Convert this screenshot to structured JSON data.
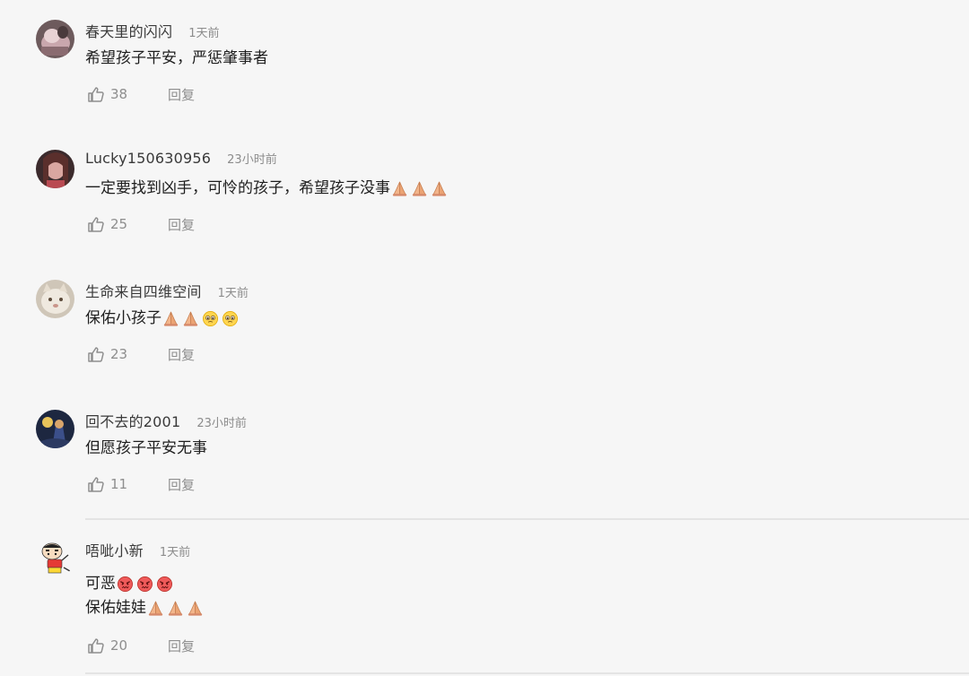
{
  "comments": [
    {
      "username": "春天里的闪闪",
      "time": "1天前",
      "lines": [
        {
          "text": "希望孩子平安，严惩肇事者",
          "emojis": []
        }
      ],
      "likes": "38",
      "reply_label": "回复",
      "avatar_icon": "avatar-photo-pink"
    },
    {
      "username": "Lucky150630956",
      "time": "23小时前",
      "lines": [
        {
          "text": "一定要找到凶手，可怜的孩子，希望孩子没事",
          "emojis": [
            "pray-emoji",
            "pray-emoji",
            "pray-emoji"
          ]
        }
      ],
      "likes": "25",
      "reply_label": "回复",
      "avatar_icon": "avatar-photo-portrait"
    },
    {
      "username": "生命来自四维空间",
      "time": "1天前",
      "lines": [
        {
          "text": "保佑小孩子",
          "emojis": [
            "pray-emoji",
            "pray-emoji",
            "pleading-emoji",
            "pleading-emoji"
          ]
        }
      ],
      "likes": "23",
      "reply_label": "回复",
      "avatar_icon": "avatar-photo-cat"
    },
    {
      "username": "回不去的2001",
      "time": "23小时前",
      "lines": [
        {
          "text": "但愿孩子平安无事",
          "emojis": []
        }
      ],
      "likes": "11",
      "reply_label": "回复",
      "avatar_icon": "avatar-photo-night"
    },
    {
      "username": "唔呲小新",
      "time": "1天前",
      "lines": [
        {
          "text": "可恶",
          "emojis": [
            "angry-emoji",
            "angry-emoji",
            "angry-emoji"
          ]
        },
        {
          "text": "保佑娃娃",
          "emojis": [
            "pray-emoji",
            "pray-emoji",
            "pray-emoji"
          ]
        }
      ],
      "likes": "20",
      "reply_label": "回复",
      "avatar_icon": "avatar-cartoon-shinchan"
    }
  ],
  "colors": {
    "background": "#f6f6f6",
    "username": "#3a3a3a",
    "meta": "#8c8c8c",
    "divider": "#e4e4e4"
  }
}
